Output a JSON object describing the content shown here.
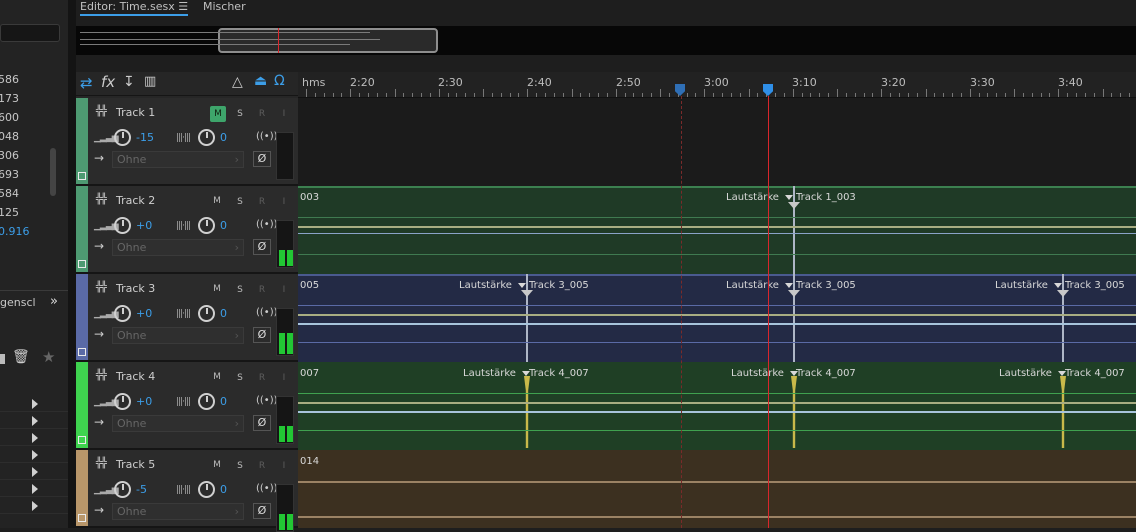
{
  "left_panel": {
    "numbers": [
      "586",
      "173",
      "600",
      "048",
      "306",
      "693",
      "584",
      "125",
      "0.916"
    ],
    "panel_label": "genscl",
    "expand_icon": "double-chevron-right-icon"
  },
  "tabs": {
    "editor": "Editor: Time.sesx",
    "mixer": "Mischer"
  },
  "ruler": {
    "unit": "hms",
    "labels": [
      "2:20",
      "2:30",
      "2:40",
      "2:50",
      "3:00",
      "3:10",
      "3:20",
      "3:30",
      "3:40"
    ]
  },
  "tracks": [
    {
      "name": "Track 1",
      "color": "#4e9a72",
      "volume": "-15",
      "pan": "0",
      "input": "Ohne",
      "monitor_on": true,
      "clip_prefix": "",
      "meter": [
        0,
        0
      ]
    },
    {
      "name": "Track 2",
      "color": "#4e9a72",
      "volume": "+0",
      "pan": "0",
      "input": "Ohne",
      "monitor_on": false,
      "clip_prefix": "003",
      "meter": [
        0.35,
        0.35
      ]
    },
    {
      "name": "Track 3",
      "color": "#5a6aa6",
      "volume": "+0",
      "pan": "0",
      "input": "Ohne",
      "monitor_on": false,
      "clip_prefix": "005",
      "meter": [
        0.45,
        0.45
      ]
    },
    {
      "name": "Track 4",
      "color": "#3fd34f",
      "volume": "+0",
      "pan": "0",
      "input": "Ohne",
      "monitor_on": false,
      "clip_prefix": "007",
      "meter": [
        0.35,
        0.35
      ]
    },
    {
      "name": "Track 5",
      "color": "#b8966a",
      "volume": "-5",
      "pan": "0",
      "input": "Ohne",
      "monitor_on": false,
      "clip_prefix": "014",
      "meter": [
        0.35,
        0.35
      ]
    }
  ],
  "clip_labels": {
    "volume": "Lautstärke",
    "track1_003": "Track 1_003",
    "track3_005": "Track 3_005",
    "track4_007": "Track 4_007"
  },
  "buttons": {
    "mute": "M",
    "solo": "S",
    "arm": "R",
    "input": "I",
    "phase": "Ø",
    "fx": "fx"
  },
  "colors": {
    "playhead": "#d9262c",
    "accent": "#3c9ee8",
    "track2_bg": "#1f3a26",
    "track3_bg": "#232a45",
    "track4_bg": "#1f3f25",
    "track5_bg": "#3c3020"
  }
}
